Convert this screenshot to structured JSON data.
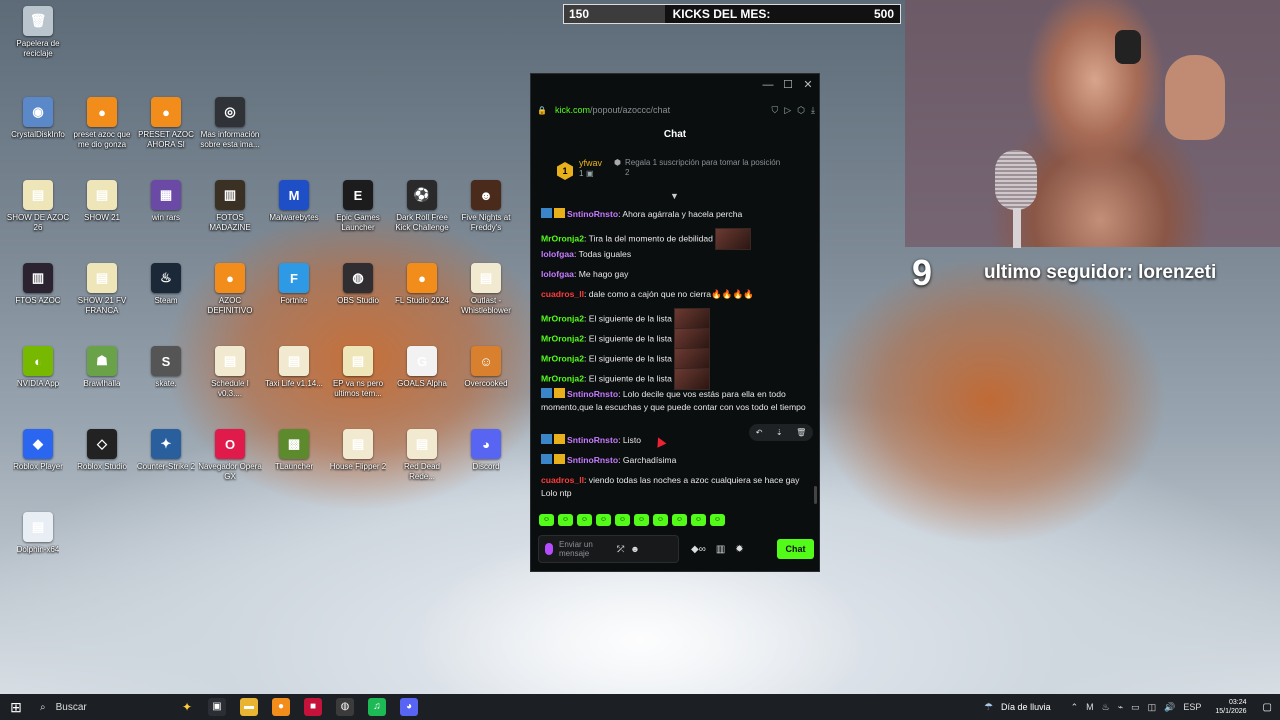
{
  "desktop_icons": [
    {
      "label": "Papelera de reciclaje",
      "icon": "recycle-bin-icon",
      "color": "#b9c4cc",
      "glyph": "🗑"
    },
    {
      "label": "CrystalDiskInfo",
      "icon": "crystaldiskinfo-icon",
      "color": "#5a88c9",
      "glyph": "◉"
    },
    {
      "label": "preset azoc que me dio gonza",
      "icon": "fl-studio-icon",
      "color": "#f28c1b",
      "glyph": "●"
    },
    {
      "label": "PRESET AZOC AHORA SI",
      "icon": "fl-studio-icon",
      "color": "#f28c1b",
      "glyph": "●"
    },
    {
      "label": "Mas información sobre esta ima...",
      "icon": "info-camera-icon",
      "color": "#2f3338",
      "glyph": "◎"
    },
    {
      "label": "SHOW DE AZOC 26",
      "icon": "document-icon",
      "color": "#eee6b8",
      "glyph": "▤"
    },
    {
      "label": "SHOW 21",
      "icon": "document-icon",
      "color": "#eee6b8",
      "glyph": "▤"
    },
    {
      "label": "win rars",
      "icon": "winrar-icon",
      "color": "#6b4aa6",
      "glyph": "▦"
    },
    {
      "label": "FOTOS MADAZINE",
      "icon": "folder-icon",
      "color": "#3a3024",
      "glyph": "▥"
    },
    {
      "label": "Malwarebytes",
      "icon": "malwarebytes-icon",
      "color": "#1e4fc7",
      "glyph": "M"
    },
    {
      "label": "Epic Games Launcher",
      "icon": "epic-games-icon",
      "color": "#1c1c1c",
      "glyph": "E"
    },
    {
      "label": "Dark Roll Free Kick Challenge",
      "icon": "soccer-ball-icon",
      "color": "#2a2a2a",
      "glyph": "⚽"
    },
    {
      "label": "Five Nights at Freddy's",
      "icon": "fnaf-icon",
      "color": "#4a2a1a",
      "glyph": "☻"
    },
    {
      "label": "FTOS AZOC",
      "icon": "folder-icon",
      "color": "#2b2430",
      "glyph": "▥"
    },
    {
      "label": "SHOW 21 FV FRANCA",
      "icon": "document-icon",
      "color": "#eee6b8",
      "glyph": "▤"
    },
    {
      "label": "Steam",
      "icon": "steam-icon",
      "color": "#1b2838",
      "glyph": "♨"
    },
    {
      "label": "AZOC DEFINITIVO",
      "icon": "fl-studio-icon",
      "color": "#f28c1b",
      "glyph": "●"
    },
    {
      "label": "Fortnite",
      "icon": "fortnite-icon",
      "color": "#2e9ae6",
      "glyph": "F"
    },
    {
      "label": "OBS Studio",
      "icon": "obs-icon",
      "color": "#302e31",
      "glyph": "◍"
    },
    {
      "label": "FL Studio 2024",
      "icon": "fl-studio-icon",
      "color": "#f28c1b",
      "glyph": "●"
    },
    {
      "label": "Outlast - Whistleblower",
      "icon": "document-icon",
      "color": "#f2ead0",
      "glyph": "▤"
    },
    {
      "label": "NVIDIA App",
      "icon": "nvidia-icon",
      "color": "#76b900",
      "glyph": "◐"
    },
    {
      "label": "Brawlhalla",
      "icon": "brawlhalla-icon",
      "color": "#6aa24a",
      "glyph": "☗"
    },
    {
      "label": "skate.",
      "icon": "skate-icon",
      "color": "#555555",
      "glyph": "S"
    },
    {
      "label": "Schedule I v0.3....",
      "icon": "document-icon",
      "color": "#f2ead0",
      "glyph": "▤"
    },
    {
      "label": "Taxi Life v1.14...",
      "icon": "document-icon",
      "color": "#f2ead0",
      "glyph": "▤"
    },
    {
      "label": "EP va ns pero ultimos tem...",
      "icon": "document-icon",
      "color": "#eee6b8",
      "glyph": "▤"
    },
    {
      "label": "GOALS Alpha",
      "icon": "goals-icon",
      "color": "#f2f2f2",
      "glyph": "G"
    },
    {
      "label": "Overcooked",
      "icon": "overcooked-icon",
      "color": "#d9802e",
      "glyph": "☺"
    },
    {
      "label": "Roblox Player",
      "icon": "roblox-icon",
      "color": "#2b66f0",
      "glyph": "◆"
    },
    {
      "label": "Roblox Studio",
      "icon": "roblox-studio-icon",
      "color": "#222222",
      "glyph": "◇"
    },
    {
      "label": "Counter-Strike 2",
      "icon": "counter-strike-icon",
      "color": "#2a5f9e",
      "glyph": "✦"
    },
    {
      "label": "Navegador Opera GX",
      "icon": "opera-gx-icon",
      "color": "#e01b4b",
      "glyph": "O"
    },
    {
      "label": "TLauncher",
      "icon": "minecraft-icon",
      "color": "#5e8a2e",
      "glyph": "▩"
    },
    {
      "label": "House Flipper 2",
      "icon": "document-icon",
      "color": "#f2ead0",
      "glyph": "▤"
    },
    {
      "label": "Red Dead Rede...",
      "icon": "document-icon",
      "color": "#f2ead0",
      "glyph": "▤"
    },
    {
      "label": "Discord",
      "icon": "discord-icon",
      "color": "#5865f2",
      "glyph": "◕"
    },
    {
      "label": "Dolphin-x64",
      "icon": "document-icon",
      "color": "#e9eef5",
      "glyph": "▤"
    }
  ],
  "overlay": {
    "kicks_current": "150",
    "kicks_label": "KICKS DEL MES:",
    "kicks_goal": "500",
    "kicks_progress": 0.3,
    "follower_count": "9",
    "follower_text": "ultimo seguidor: lorenzeti"
  },
  "chat_window": {
    "url_host": "kick.com",
    "url_path": "/popout/azoccc/chat",
    "title": "Chat",
    "pinned": {
      "user": "yfwav",
      "badge_number": "1",
      "count": "1",
      "promo_text": "Regala 1 suscripción para tomar la posición",
      "promo_rank": "2"
    },
    "messages": [
      {
        "user": "SntinoRnsto",
        "user_color": "#c67bff",
        "badges": true,
        "text": ": Ahora agárrala y hacela percha"
      },
      {
        "user": "MrOronja2",
        "user_color": "#53fc18",
        "badges": false,
        "text": ": Tira la del momento de debilidad",
        "emote": true
      },
      {
        "user": "lolofgaa",
        "user_color": "#c67bff",
        "badges": false,
        "text": ": Todas iguales"
      },
      {
        "user": "lolofgaa",
        "user_color": "#c67bff",
        "badges": false,
        "text": ": Me hago gay"
      },
      {
        "user": "cuadros_ll",
        "user_color": "#ff3b3b",
        "badges": false,
        "text": ": dale como a cajón que no cierra",
        "fire": "🔥🔥🔥🔥"
      },
      {
        "user": "MrOronja2",
        "user_color": "#53fc18",
        "badges": false,
        "text": ": El siguiente de la lista",
        "emote": true
      },
      {
        "user": "MrOronja2",
        "user_color": "#53fc18",
        "badges": false,
        "text": ": El siguiente de la lista",
        "emote": true
      },
      {
        "user": "MrOronja2",
        "user_color": "#53fc18",
        "badges": false,
        "text": ": El siguiente de la lista",
        "emote": true
      },
      {
        "user": "MrOronja2",
        "user_color": "#53fc18",
        "badges": false,
        "text": ": El siguiente de la lista",
        "emote": true
      },
      {
        "user": "SntinoRnsto",
        "user_color": "#c67bff",
        "badges": true,
        "text": ": Lolo decile que vos estás para ella en todo momento,que la escuchas y que puede contar con vos todo el tiempo"
      },
      {
        "user": "SntinoRnsto",
        "user_color": "#c67bff",
        "badges": true,
        "text": ": Listo"
      },
      {
        "user": "SntinoRnsto",
        "user_color": "#c67bff",
        "badges": true,
        "text": ": Garchadísima"
      },
      {
        "user": "cuadros_ll",
        "user_color": "#ff3b3b",
        "badges": false,
        "text": ": viendo todas las noches a azoc cualquiera se hace gay Lolo ntp"
      }
    ],
    "input_placeholder": "Enviar un mensaje",
    "send_label": "Chat"
  },
  "taskbar": {
    "search_label": "Buscar",
    "weather": "Día de lluvia",
    "language": "ESP",
    "time": "03:24",
    "date": "15/1/2026",
    "apps": [
      {
        "icon": "task-view-icon",
        "color": "#2b2f35",
        "glyph": "▣"
      },
      {
        "icon": "file-explorer-icon",
        "color": "#e8b431",
        "glyph": "▬"
      },
      {
        "icon": "fl-studio-icon",
        "color": "#f28c1b",
        "glyph": "●"
      },
      {
        "icon": "app-icon",
        "color": "#c4123a",
        "glyph": "■"
      },
      {
        "icon": "obs-icon",
        "color": "#3b3b3b",
        "glyph": "◍"
      },
      {
        "icon": "spotify-icon",
        "color": "#1db954",
        "glyph": "♫"
      },
      {
        "icon": "discord-icon",
        "color": "#5865f2",
        "glyph": "◕"
      }
    ]
  }
}
